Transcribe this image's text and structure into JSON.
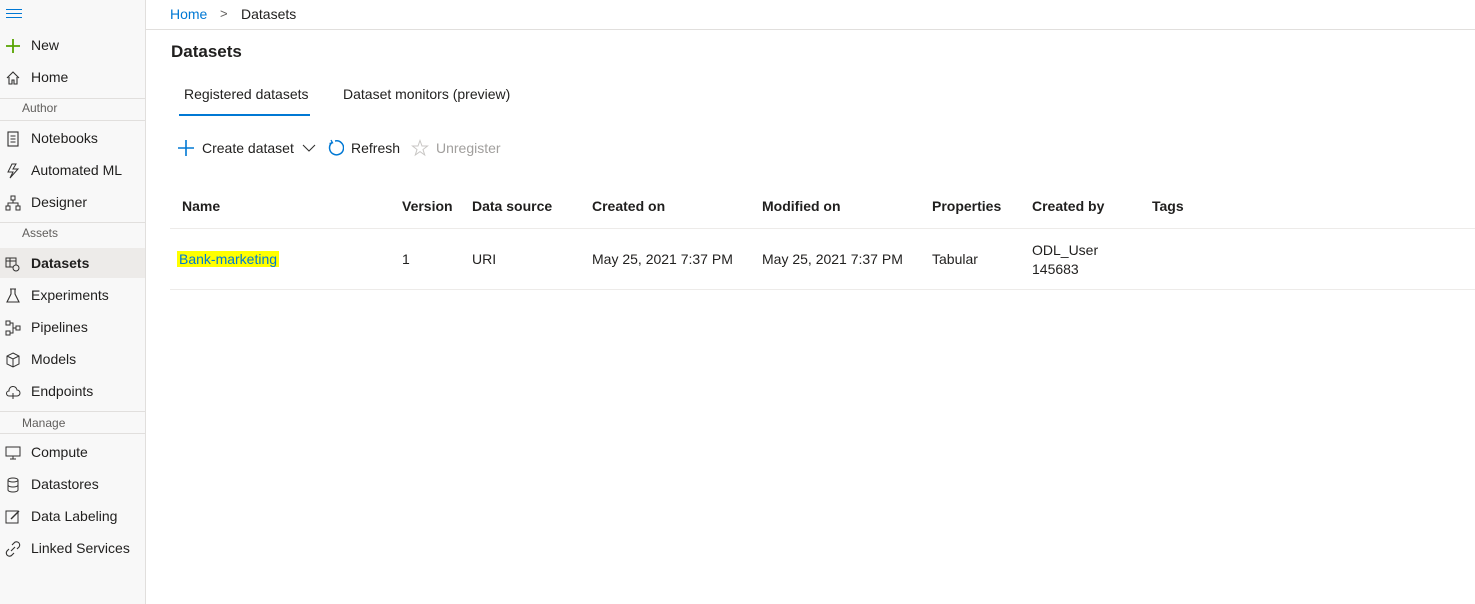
{
  "sidebar": {
    "new_label": "New",
    "home_label": "Home",
    "sections": {
      "author": "Author",
      "assets": "Assets",
      "manage": "Manage"
    },
    "items": [
      {
        "label": "Notebooks",
        "icon": "notebook-icon"
      },
      {
        "label": "Automated ML",
        "icon": "automated-ml-icon"
      },
      {
        "label": "Designer",
        "icon": "designer-icon"
      },
      {
        "label": "Datasets",
        "icon": "datasets-icon"
      },
      {
        "label": "Experiments",
        "icon": "flask-icon"
      },
      {
        "label": "Pipelines",
        "icon": "pipeline-icon"
      },
      {
        "label": "Models",
        "icon": "cube-icon"
      },
      {
        "label": "Endpoints",
        "icon": "cloud-icon"
      },
      {
        "label": "Compute",
        "icon": "monitor-icon"
      },
      {
        "label": "Datastores",
        "icon": "database-icon"
      },
      {
        "label": "Data Labeling",
        "icon": "edit-icon"
      },
      {
        "label": "Linked Services",
        "icon": "link-icon"
      }
    ],
    "active_item": "Datasets"
  },
  "breadcrumb": {
    "home": "Home",
    "separator": ">",
    "current": "Datasets"
  },
  "page": {
    "title": "Datasets"
  },
  "tabs": [
    {
      "label": "Registered datasets",
      "active": true
    },
    {
      "label": "Dataset monitors (preview)",
      "active": false
    }
  ],
  "commands": {
    "create": "Create dataset",
    "refresh": "Refresh",
    "unregister": "Unregister"
  },
  "table": {
    "headers": [
      "Name",
      "Version",
      "Data source",
      "Created on",
      "Modified on",
      "Properties",
      "Created by",
      "Tags"
    ],
    "rows": [
      {
        "name": "Bank-marketing",
        "version": "1",
        "data_source": "URI",
        "created_on": "May 25, 2021 7:37 PM",
        "modified_on": "May 25, 2021 7:37 PM",
        "properties": "Tabular",
        "created_by_line1": "ODL_User",
        "created_by_line2": "145683",
        "tags": ""
      }
    ]
  },
  "colors": {
    "accent": "#0078d4",
    "new_plus": "#57a300",
    "highlight": "#ffff00"
  }
}
